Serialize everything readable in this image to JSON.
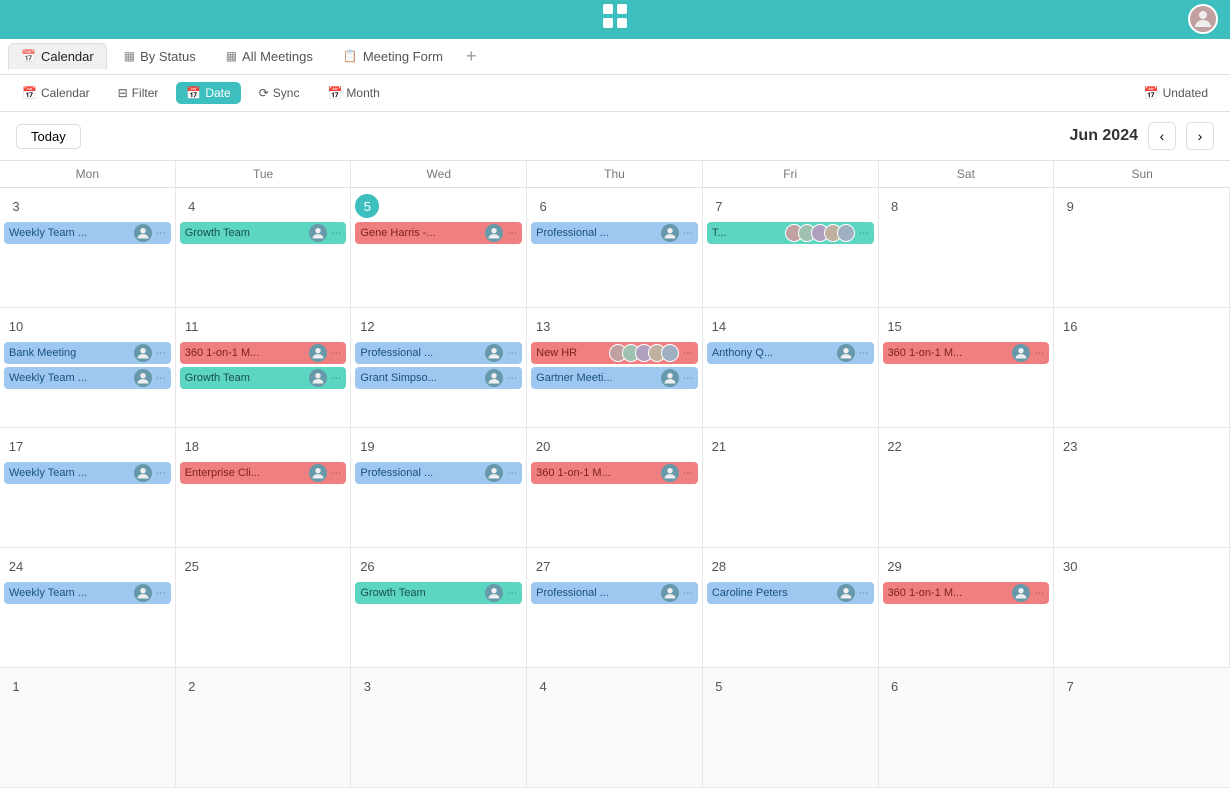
{
  "topbar": {
    "logo": "⠿",
    "logo_symbol": "☰"
  },
  "tabs": {
    "items": [
      {
        "id": "calendar",
        "label": "Calendar",
        "icon": "📅",
        "active": true
      },
      {
        "id": "by-status",
        "label": "By Status",
        "icon": "▦"
      },
      {
        "id": "all-meetings",
        "label": "All Meetings",
        "icon": "▦"
      },
      {
        "id": "meeting-form",
        "label": "Meeting Form",
        "icon": "📋"
      }
    ],
    "add_label": "+"
  },
  "toolbar": {
    "calendar_label": "Calendar",
    "filter_label": "Filter",
    "date_label": "Date",
    "sync_label": "Sync",
    "month_label": "Month",
    "undated_label": "Undated"
  },
  "cal_header": {
    "today_label": "Today",
    "month_year": "Jun 2024"
  },
  "day_headers": [
    "Mon",
    "Tue",
    "Wed",
    "Thu",
    "Fri",
    "Sat",
    "Sun"
  ],
  "weeks": [
    {
      "days": [
        {
          "date": "3",
          "other": false,
          "events": [
            {
              "label": "Weekly Team ...",
              "color": "ev-blue",
              "avatar": "person",
              "dots": true
            }
          ]
        },
        {
          "date": "4",
          "other": false,
          "events": [
            {
              "label": "Growth Team",
              "color": "ev-teal",
              "avatar": "person",
              "dots": true
            }
          ]
        },
        {
          "date": "5",
          "other": false,
          "today": true,
          "events": [
            {
              "label": "Gene Harris -...",
              "color": "ev-pink",
              "avatar": "person",
              "dots": true
            }
          ]
        },
        {
          "date": "6",
          "other": false,
          "events": [
            {
              "label": "Professional ...",
              "color": "ev-blue",
              "avatar": "person",
              "dots": true
            }
          ]
        },
        {
          "date": "7",
          "other": false,
          "events": [
            {
              "label": "T...",
              "color": "ev-teal",
              "multi_avatar": true,
              "dots": true
            }
          ]
        },
        {
          "date": "8",
          "other": false,
          "events": []
        },
        {
          "date": "9",
          "other": false,
          "events": []
        }
      ]
    },
    {
      "days": [
        {
          "date": "10",
          "other": false,
          "events": [
            {
              "label": "Bank Meeting",
              "color": "ev-blue",
              "avatar": "person",
              "dots": true
            },
            {
              "label": "Weekly Team ...",
              "color": "ev-blue",
              "avatar": "person",
              "dots": true
            }
          ]
        },
        {
          "date": "11",
          "other": false,
          "events": [
            {
              "label": "360 1-on-1 M...",
              "color": "ev-pink",
              "avatar": "person",
              "dots": true
            },
            {
              "label": "Growth Team",
              "color": "ev-teal",
              "avatar": "person",
              "dots": true
            }
          ]
        },
        {
          "date": "12",
          "other": false,
          "events": [
            {
              "label": "Professional ...",
              "color": "ev-blue",
              "avatar": "person",
              "dots": true
            },
            {
              "label": "Grant Simpso...",
              "color": "ev-blue",
              "avatar": "person",
              "dots": true
            }
          ]
        },
        {
          "date": "13",
          "other": false,
          "events": [
            {
              "label": "New HR",
              "color": "ev-pink",
              "multi_avatar": true,
              "dots": true
            },
            {
              "label": "Gartner Meeti...",
              "color": "ev-blue",
              "avatar": "person",
              "dots": true
            }
          ]
        },
        {
          "date": "14",
          "other": false,
          "events": [
            {
              "label": "Anthony Q...",
              "color": "ev-blue",
              "avatar": "person",
              "dots": true
            }
          ]
        },
        {
          "date": "15",
          "other": false,
          "events": [
            {
              "label": "360 1-on-1 M...",
              "color": "ev-pink",
              "avatar": "person",
              "dots": true
            }
          ]
        },
        {
          "date": "16",
          "other": false,
          "events": []
        }
      ]
    },
    {
      "days": [
        {
          "date": "17",
          "other": false,
          "events": [
            {
              "label": "Weekly Team ...",
              "color": "ev-blue",
              "avatar": "person",
              "dots": true
            }
          ]
        },
        {
          "date": "18",
          "other": false,
          "events": [
            {
              "label": "Enterprise Cli...",
              "color": "ev-pink",
              "avatar": "person",
              "dots": true
            }
          ]
        },
        {
          "date": "19",
          "other": false,
          "events": [
            {
              "label": "Professional ...",
              "color": "ev-blue",
              "avatar": "person",
              "dots": true
            }
          ]
        },
        {
          "date": "20",
          "other": false,
          "events": [
            {
              "label": "360 1-on-1 M...",
              "color": "ev-pink",
              "avatar": "person",
              "dots": true
            }
          ]
        },
        {
          "date": "21",
          "other": false,
          "events": []
        },
        {
          "date": "22",
          "other": false,
          "events": []
        },
        {
          "date": "23",
          "other": false,
          "events": []
        }
      ]
    },
    {
      "days": [
        {
          "date": "24",
          "other": false,
          "events": [
            {
              "label": "Weekly Team ...",
              "color": "ev-blue",
              "avatar": "person",
              "dots": true
            }
          ]
        },
        {
          "date": "25",
          "other": false,
          "events": []
        },
        {
          "date": "26",
          "other": false,
          "events": [
            {
              "label": "Growth Team",
              "color": "ev-teal",
              "avatar": "person",
              "dots": true
            }
          ]
        },
        {
          "date": "27",
          "other": false,
          "events": [
            {
              "label": "Professional ...",
              "color": "ev-blue",
              "avatar": "person",
              "dots": true
            }
          ]
        },
        {
          "date": "28",
          "other": false,
          "events": [
            {
              "label": "Caroline Peters",
              "color": "ev-blue",
              "avatar": "person",
              "dots": true
            }
          ]
        },
        {
          "date": "29",
          "other": false,
          "events": [
            {
              "label": "360 1-on-1 M...",
              "color": "ev-pink",
              "avatar": "person",
              "dots": true
            }
          ]
        },
        {
          "date": "30",
          "other": false,
          "events": []
        }
      ]
    },
    {
      "days": [
        {
          "date": "1",
          "other": true,
          "events": []
        },
        {
          "date": "2",
          "other": true,
          "events": []
        },
        {
          "date": "3",
          "other": true,
          "events": []
        },
        {
          "date": "4",
          "other": true,
          "events": []
        },
        {
          "date": "5",
          "other": true,
          "events": []
        },
        {
          "date": "6",
          "other": true,
          "events": []
        },
        {
          "date": "7",
          "other": true,
          "events": []
        }
      ]
    }
  ]
}
